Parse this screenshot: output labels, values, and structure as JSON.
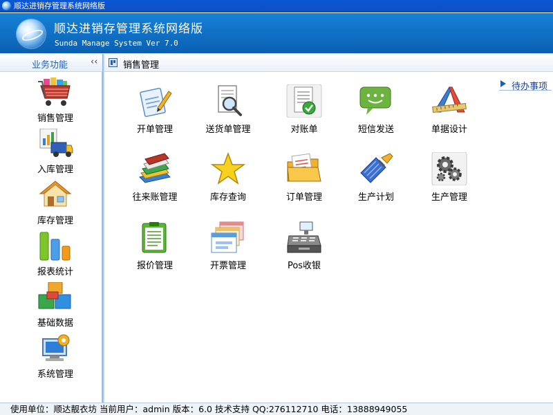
{
  "window": {
    "title": "顺达进销存管理系统网络版"
  },
  "banner": {
    "title": "顺达进销存管理系统网络版",
    "subtitle": "Sunda Manage System Ver 7.0"
  },
  "sidebar": {
    "title": "业务功能",
    "collapse_label": "‹‹",
    "items": [
      {
        "label": "销售管理",
        "icon": "shopping-cart-icon"
      },
      {
        "label": "入库管理",
        "icon": "truck-icon"
      },
      {
        "label": "库存管理",
        "icon": "house-icon"
      },
      {
        "label": "报表统计",
        "icon": "bar-chart-icon"
      },
      {
        "label": "基础数据",
        "icon": "boxes-icon"
      },
      {
        "label": "系统管理",
        "icon": "computer-icon"
      }
    ]
  },
  "main": {
    "header": "销售管理",
    "todo_label": "待办事项",
    "apps": [
      {
        "label": "开单管理",
        "icon": "pen-document-icon"
      },
      {
        "label": "送货单管理",
        "icon": "magnifier-document-icon"
      },
      {
        "label": "对账单",
        "icon": "checked-document-icon"
      },
      {
        "label": "短信发送",
        "icon": "chat-bubble-icon"
      },
      {
        "label": "单据设计",
        "icon": "drafting-tools-icon"
      },
      {
        "label": "往来账管理",
        "icon": "books-icon"
      },
      {
        "label": "库存查询",
        "icon": "star-icon"
      },
      {
        "label": "订单管理",
        "icon": "folder-documents-icon"
      },
      {
        "label": "生产计划",
        "icon": "brush-tool-icon"
      },
      {
        "label": "生产管理",
        "icon": "gears-icon"
      },
      {
        "label": "报价管理",
        "icon": "clipboard-list-icon"
      },
      {
        "label": "开票管理",
        "icon": "invoice-windows-icon"
      },
      {
        "label": "Pos收银",
        "icon": "cash-register-icon"
      }
    ]
  },
  "statusbar": {
    "text": "使用单位：顺达靓衣坊  当前用户：admin  版本：6.0  技术支持 QQ:276112710 电话：13888949055"
  }
}
